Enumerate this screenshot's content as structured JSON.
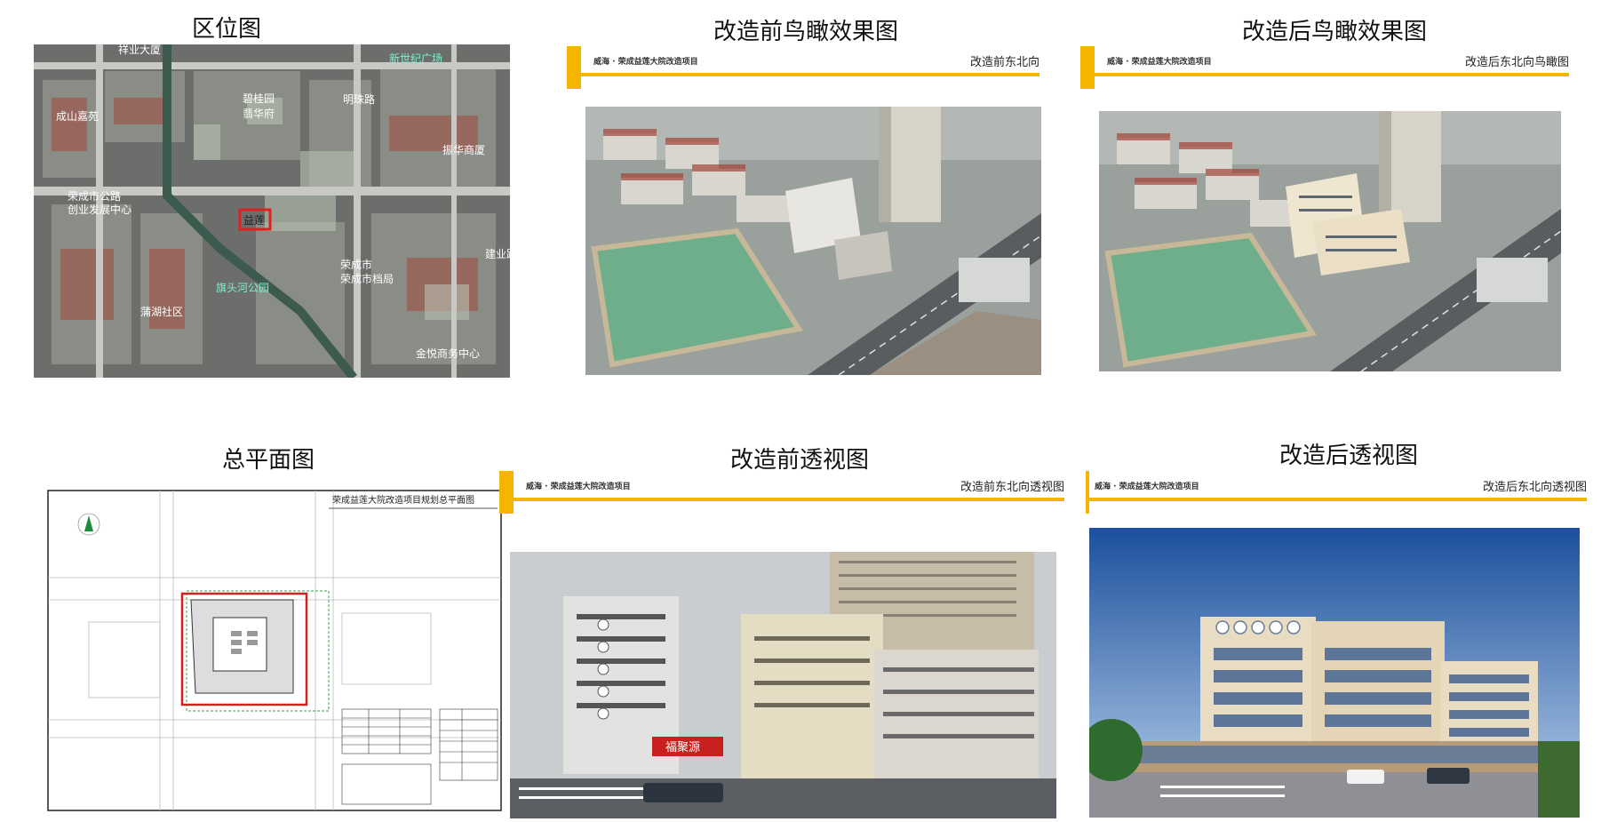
{
  "panels": {
    "location": {
      "title": "区位图",
      "map_labels": [
        "祥业大厦",
        "新世纪广场",
        "碧桂园",
        "翡华府",
        "明珠路",
        "振华商厦",
        "成山嘉苑",
        "荣成市公路",
        "创业发展中心",
        "益莲",
        "荣成市",
        "荣成市档局",
        "旗头河公园",
        "蒲湖社区",
        "金悦商务中心",
        "建业路"
      ]
    },
    "before_aerial": {
      "title": "改造前鸟瞰效果图",
      "project": "威海 · 荣成益莲大院改造项目",
      "direction": "改造前东北向"
    },
    "after_aerial": {
      "title": "改造后鸟瞰效果图",
      "project": "威海 · 荣成益莲大院改造项目",
      "direction": "改造后东北向鸟瞰图"
    },
    "site_plan": {
      "title": "总平面图",
      "drawing_title": "荣成益莲大院改造项目规划总平面图"
    },
    "before_perspective": {
      "title": "改造前透视图",
      "project": "威海 · 荣成益莲大院改造项目",
      "direction": "改造前东北向透视图",
      "shop_sign": "福聚源"
    },
    "after_perspective": {
      "title": "改造后透视图",
      "project": "威海 · 荣成益莲大院改造项目",
      "direction": "改造后东北向透视图"
    }
  },
  "colors": {
    "accent": "#f5b400",
    "site_boundary": "#d62020",
    "map_label": "#7ff0d0"
  }
}
